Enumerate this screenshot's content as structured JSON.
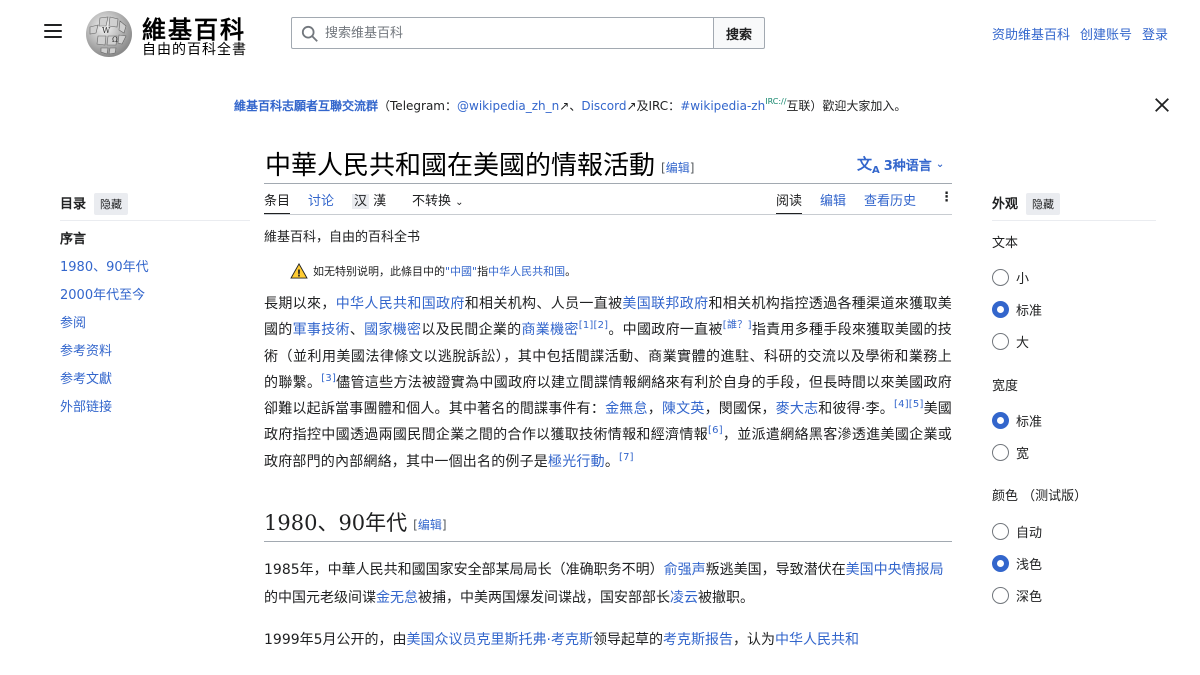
{
  "header": {
    "logo_title": "維基百科",
    "logo_tagline": "自由的百科全書",
    "search_placeholder": "搜索维基百科",
    "search_button": "搜索",
    "user_links": [
      "资助维基百科",
      "创建账号",
      "登录"
    ]
  },
  "banner": {
    "name": "維基百科志願者互聯交流群",
    "open": "（Telegram：",
    "telegram": "@wikipedia_zh_n",
    "sep": "、",
    "discord": "Discord",
    "and": "及IRC：",
    "irc": "#wikipedia-zh",
    "ext": "IRC://",
    "close_text": "互联）歡迎大家加入。"
  },
  "title": {
    "text": "中華人民共和國在美國的情報活動",
    "edit": "编辑",
    "languages": "3种语言"
  },
  "tabs": {
    "article": "条目",
    "talk": "讨论",
    "variant_a": "汉",
    "variant_b": "漢",
    "convert": "不转换",
    "read": "阅读",
    "edit": "编辑",
    "history": "查看历史"
  },
  "toc": {
    "title": "目录",
    "hide": "隐藏",
    "items": [
      "序言",
      "1980、90年代",
      "2000年代至今",
      "参阅",
      "参考资料",
      "参考文獻",
      "外部链接"
    ]
  },
  "appearance": {
    "title": "外观",
    "hide": "隐藏",
    "text_label": "文本",
    "text_options": [
      "小",
      "标准",
      "大"
    ],
    "width_label": "宽度",
    "width_options": [
      "标准",
      "宽"
    ],
    "color_label": "颜色 （测试版）",
    "color_options": [
      "自动",
      "浅色",
      "深色"
    ]
  },
  "content": {
    "from": "維基百科，自由的百科全书",
    "hatnote_a": "如无特别说明，此條目中的",
    "hatnote_link1": "\"中國\"",
    "hatnote_b": "指",
    "hatnote_link2": "中华人民共和国",
    "hatnote_c": "。",
    "section1": "1980、90年代",
    "section_edit": "编辑"
  }
}
